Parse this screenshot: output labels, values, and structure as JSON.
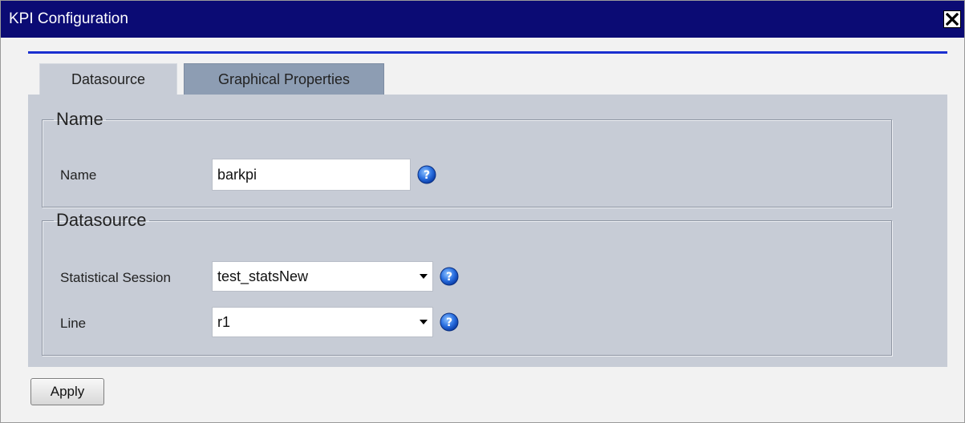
{
  "window": {
    "title": "KPI Configuration",
    "close_icon": "close-x-icon"
  },
  "tabs": [
    {
      "label": "Datasource",
      "active": true
    },
    {
      "label": "Graphical Properties",
      "active": false
    }
  ],
  "name_section": {
    "legend": "Name",
    "name_label": "Name",
    "name_value": "barkpi",
    "help_icon": "question-mark-icon"
  },
  "datasource_section": {
    "legend": "Datasource",
    "session_label": "Statistical Session",
    "session_value": "test_statsNew",
    "line_label": "Line",
    "line_value": "r1",
    "help_icon": "question-mark-icon"
  },
  "apply_label": "Apply",
  "colors": {
    "titlebar": "#0b0b74",
    "rule": "#1a2fd0",
    "active_tab": "#c7ccd6",
    "inactive_tab": "#8d9db3"
  }
}
